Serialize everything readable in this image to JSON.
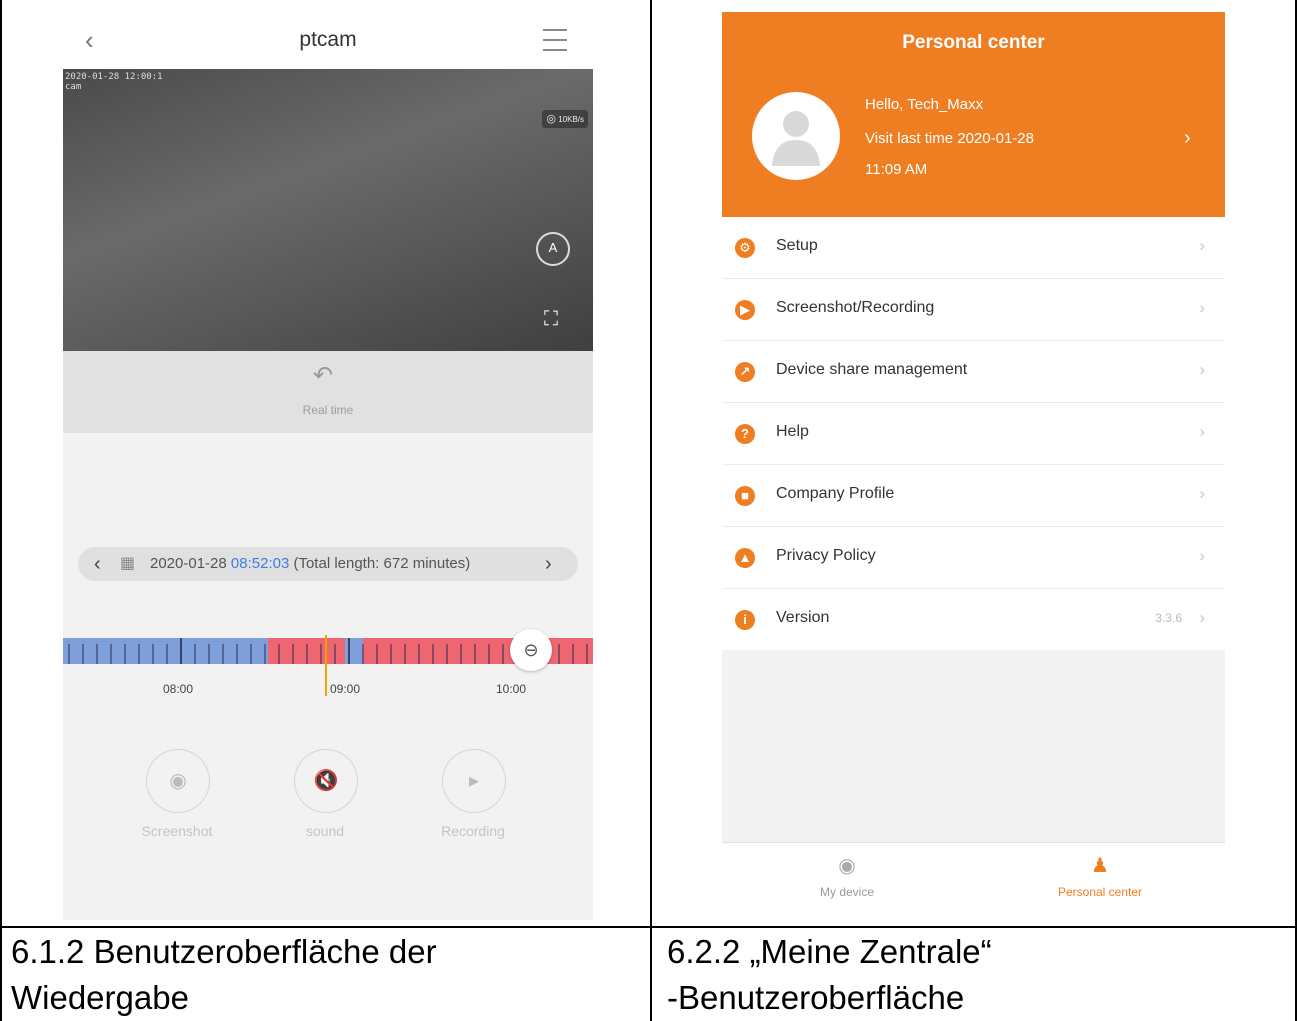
{
  "left_screen": {
    "title": "ptcam",
    "osd_text": "2020-01-28 12:00:1",
    "osd_label": "cam",
    "wifi_speed": "10KB/s",
    "realtime_label": "Real time",
    "date": "2020-01-28",
    "time": "08:52:03",
    "total_length": "(Total length: 672 minutes)",
    "timeline_ticks": [
      "08:00",
      "09:00",
      "10:00"
    ],
    "controls": [
      "Screenshot",
      "sound",
      "Recording"
    ],
    "colors": {
      "recorded_blue": "#7e9fda",
      "recorded_red": "#ee6670",
      "cursor": "#f2a300",
      "time_accent": "#3d7fdc"
    },
    "icons": {
      "back": "chevron-left-icon",
      "menu": "hamburger-icon",
      "auto": "auto-rotate-icon",
      "fullscreen": "fullscreen-icon",
      "zoom": "zoom-icon"
    }
  },
  "right_screen": {
    "title": "Personal center",
    "greeting": "Hello, Tech_Maxx",
    "visit_line": "Visit last time 2020-01-28",
    "visit_time": "11:09 AM",
    "menu": [
      {
        "label": "Setup",
        "icon": "gear-icon"
      },
      {
        "label": "Screenshot/Recording",
        "icon": "video-icon"
      },
      {
        "label": "Device share management",
        "icon": "share-icon"
      },
      {
        "label": "Help",
        "icon": "question-icon"
      },
      {
        "label": "Company Profile",
        "icon": "company-icon"
      },
      {
        "label": "Privacy Policy",
        "icon": "shield-icon"
      },
      {
        "label": "Version",
        "icon": "info-icon",
        "value": "3.3.6"
      }
    ],
    "tabs": [
      "My device",
      "Personal center"
    ],
    "colors": {
      "accent": "#ef7d22",
      "tab_active": "#ef7d22",
      "tab_inactive": "#999999"
    }
  },
  "captions": {
    "left": [
      "6.1.2 Benutzeroberfläche der",
      "Wiedergabe"
    ],
    "right": [
      "6.2.2 „Meine Zentrale“",
      "-Benutzeroberfläche"
    ]
  }
}
